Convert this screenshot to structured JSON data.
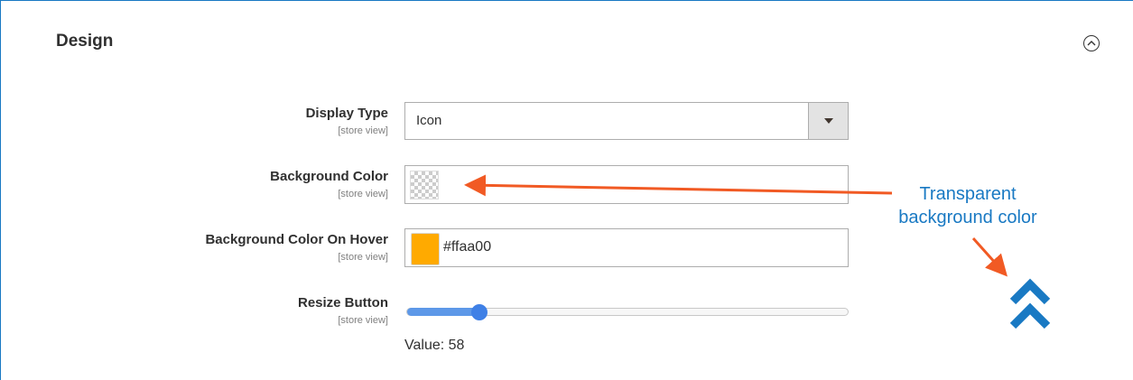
{
  "section": {
    "title": "Design"
  },
  "fields": {
    "display_type": {
      "label": "Display Type",
      "scope": "[store view]",
      "value": "Icon"
    },
    "background_color": {
      "label": "Background Color",
      "scope": "[store view]",
      "value": "",
      "color": "transparent"
    },
    "background_color_hover": {
      "label": "Background Color On Hover",
      "scope": "[store view]",
      "value": "#ffaa00",
      "color": "#ffaa00"
    },
    "resize_button": {
      "label": "Resize Button",
      "scope": "[store view]",
      "value": 58,
      "value_text": "Value: 58",
      "min": 0,
      "max": 100
    }
  },
  "annotation": {
    "line1": "Transparent",
    "line2": "background color",
    "arrow_color": "#f15a24",
    "text_color": "#1979c3"
  },
  "preview": {
    "icon": "double-chevron-up-icon",
    "color": "#1979c3"
  },
  "colors": {
    "accent": "#1979c3",
    "slider": "#3f80e6"
  }
}
